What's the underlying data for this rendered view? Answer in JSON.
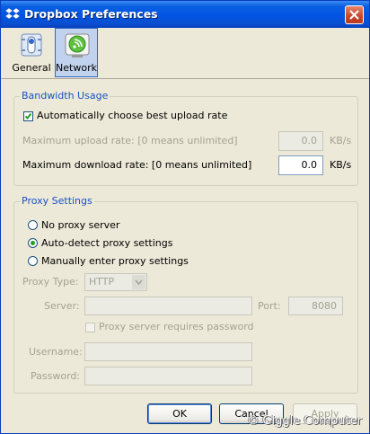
{
  "window": {
    "title": "Dropbox Preferences",
    "icon": "dropbox-icon"
  },
  "toolbar": {
    "tabs": [
      {
        "label": "General",
        "icon": "general-switch-icon",
        "selected": false
      },
      {
        "label": "Network",
        "icon": "network-icon",
        "selected": true
      }
    ]
  },
  "bandwidth": {
    "title": "Bandwidth Usage",
    "auto_label": "Automatically choose best upload rate",
    "auto_checked": true,
    "upload_label": "Maximum upload rate: [0 means unlimited]",
    "upload_value": "0.0",
    "upload_unit": "KB/s",
    "download_label": "Maximum download rate: [0 means unlimited]",
    "download_value": "0.0",
    "download_unit": "KB/s"
  },
  "proxy": {
    "title": "Proxy Settings",
    "options": [
      "No proxy server",
      "Auto-detect proxy settings",
      "Manually enter proxy settings"
    ],
    "selected_option": "Auto-detect proxy settings",
    "type_label": "Proxy Type:",
    "type_value": "HTTP",
    "server_label": "Server:",
    "server_value": "",
    "port_label": "Port:",
    "port_value": "8080",
    "requires_password_label": "Proxy server requires password",
    "username_label": "Username:",
    "username_value": "",
    "password_label": "Password:",
    "password_value": ""
  },
  "buttons": {
    "ok": "OK",
    "cancel": "Cancel",
    "apply": "Apply"
  },
  "watermark": "© Giggle Computer",
  "colors": {
    "titlebar": "#0054e3",
    "group_title": "#1a52c4",
    "selected_tab": "#c1d2ee",
    "radio_dot": "#21a121",
    "check": "#21a121"
  }
}
